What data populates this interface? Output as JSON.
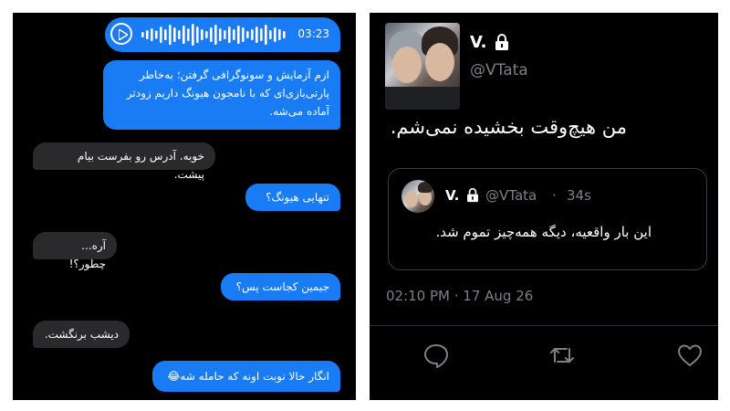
{
  "chat": {
    "voice": {
      "duration": "03:23",
      "icon": "play-icon"
    },
    "messages": [
      {
        "dir": "out",
        "text": "ازم آزمایش و سونوگرافی گرفتن؛ به‌خاطر پارتی‌بازی‌ای که با نامجون هیونگ داریم زودتر آماده می‌شه."
      },
      {
        "dir": "in",
        "text": "خوبه. آدرس رو بفرست بیام پیشت."
      },
      {
        "dir": "out",
        "text": "تنهایی هیونگ؟"
      },
      {
        "dir": "in",
        "text": "آره... چطور؟!"
      },
      {
        "dir": "out",
        "text": "جیمین کجاست پس؟"
      },
      {
        "dir": "in",
        "text": "دیشب برنگشت."
      },
      {
        "dir": "out",
        "text": "انگار حالا نوبت اونه که حامله شه😂"
      }
    ]
  },
  "tweet": {
    "name": "V.",
    "handle": "@VTata",
    "text": "من هیچ‌وقت بخشیده نمی‌شم.",
    "quote": {
      "name": "V.",
      "handle": "@VTata",
      "separator": "·",
      "time": "34s",
      "text": "این بار واقعیه، دیگه همه‌چیز تموم شد."
    },
    "date": "02:10 PM · 17 Aug 26",
    "actions": [
      "reply-icon",
      "retweet-icon",
      "like-icon"
    ]
  },
  "colors": {
    "outgoing_bubble": "#1a7cf5",
    "incoming_bubble": "#2a2a2c",
    "muted_text": "#7b8087",
    "background": "#000000"
  }
}
